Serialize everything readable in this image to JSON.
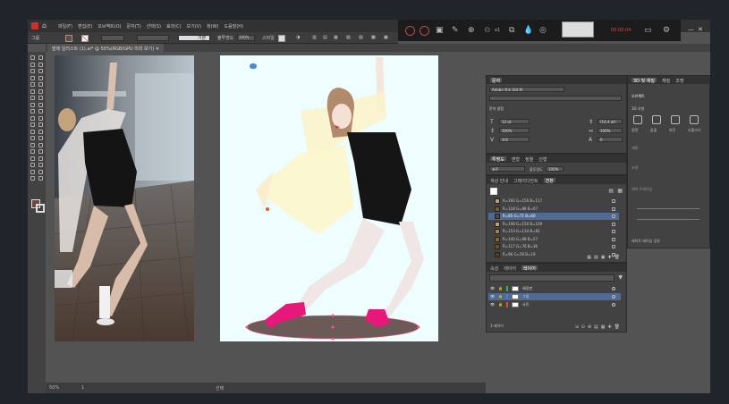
{
  "menubar": {
    "items": [
      "파일(F)",
      "편집(E)",
      "오브젝트(O)",
      "문자(T)",
      "선택(S)",
      "효과(C)",
      "보기(V)",
      "창(W)",
      "도움말(H)"
    ]
  },
  "recorder": {
    "time": "00:00:04",
    "zoom_badge": "x1"
  },
  "control_bar": {
    "group_label": "그룹",
    "stroke_style": "기본",
    "opacity_label": "불투명도",
    "opacity_value": "100%",
    "style_label": "스타일"
  },
  "document_tab": {
    "label": "발레 일러스트 (1).ai* @ 50%(RGB/GPU 미리 보기)"
  },
  "statusbar": {
    "zoom": "50%",
    "artboard_num": "1",
    "tool_name": "선택"
  },
  "character_panel": {
    "tab": "문자",
    "font_name": "Adobe 명조 Std M",
    "font_style": "-",
    "size": "12 pt",
    "leading": "(14.4 pt)",
    "vscale": "100%",
    "hscale": "100%",
    "kerning": "자동",
    "tracking": "0",
    "section": "문자 설정"
  },
  "transparency_panel": {
    "tabs": [
      "투명도",
      "변형",
      "정렬",
      "선형"
    ],
    "blend_mode": "표준",
    "opacity_label": "불투명도",
    "opacity_value": "100%"
  },
  "swatches_panel": {
    "tabs": [
      "색상 안내",
      "그레이디언트",
      "견본"
    ],
    "rows": [
      {
        "name": "R=192 G=156 B=117",
        "color": "#c09c75"
      },
      {
        "name": "R=118 G=88 B=67",
        "color": "#765843"
      },
      {
        "name": "R=85 G=71 B=60",
        "color": "#55473c"
      },
      {
        "name": "R=198 G=156 B=109",
        "color": "#c69c6d"
      },
      {
        "name": "R=153 G=134 B=82",
        "color": "#998652"
      },
      {
        "name": "R=140 G=98 B=57",
        "color": "#8c6239"
      },
      {
        "name": "R=117 G=76 B=36",
        "color": "#754c24"
      },
      {
        "name": "R=96 G=56 B=19",
        "color": "#603813"
      }
    ],
    "selected_index": 2
  },
  "layers_panel": {
    "tabs": [
      "속성",
      "레이어",
      "레이어"
    ],
    "active_tab": "레이어",
    "layers": [
      {
        "name": "배경판",
        "color": "#3cb44b"
      },
      {
        "name": "그림",
        "color": "#4a7adf"
      },
      {
        "name": "사진",
        "color": "#e0503c"
      }
    ],
    "selected_index": 1,
    "footer": "3 레이어"
  },
  "libs_panel": {
    "tabs": [
      "3D 및 재질",
      "재질",
      "조명"
    ],
    "subtab": "오브젝트",
    "section": "3D 유형",
    "types": [
      "평면",
      "돌출",
      "회전",
      "부풀리기"
    ],
    "labels": [
      "재질",
      "조명"
    ],
    "render_label": "레이 트레이싱",
    "footer": "레이트 레이싱 공유"
  },
  "colors": {
    "accent_selection": "#4e6a95",
    "shoe_pink": "#e8187a",
    "shadow": "#6b5a55",
    "artboard_bg": "#eefdfd"
  }
}
